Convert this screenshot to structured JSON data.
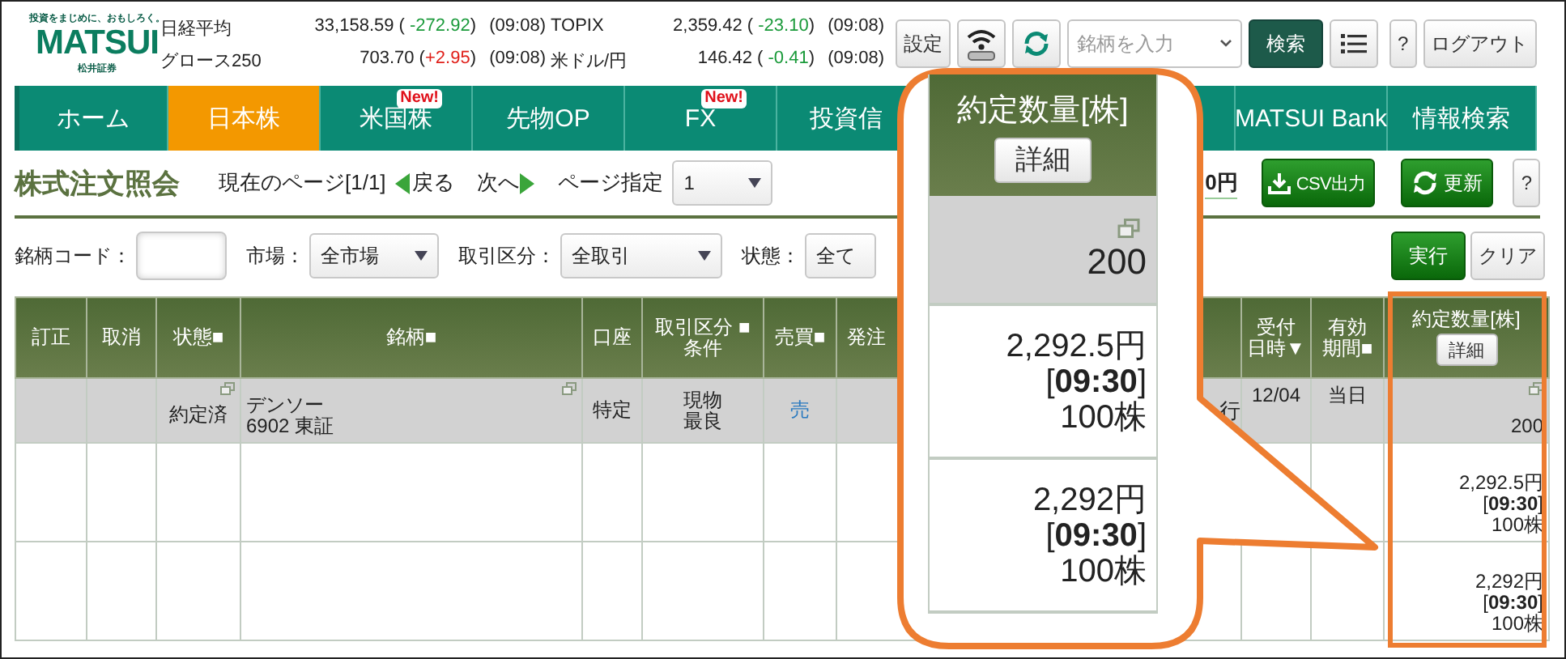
{
  "logo": {
    "tagline": "投資をまじめに、おもしろく。",
    "name": "MATSUI",
    "subname": "松井証券"
  },
  "indices": [
    {
      "name": "日経平均",
      "value": "33,158.59",
      "open": "( ",
      "change": "-272.92",
      "close": ")",
      "color": "#1a9a3a",
      "time": "(09:08)"
    },
    {
      "name": "TOPIX",
      "value": "2,359.42",
      "open": "( ",
      "change": "-23.10",
      "close": ")",
      "color": "#1a9a3a",
      "time": "(09:08)"
    },
    {
      "name": "グロース250",
      "value": "703.70",
      "open": "(",
      "change": "+2.95",
      "close": ")",
      "color": "#e0201a",
      "time": "(09:08)"
    },
    {
      "name": "米ドル/円",
      "value": "146.42",
      "open": "( ",
      "change": "-0.41",
      "close": ")",
      "color": "#1a9a3a",
      "time": "(09:08)"
    }
  ],
  "toolbar": {
    "settings": "設定",
    "search_placeholder": "銘柄を入力",
    "search_button": "検索",
    "help": "?",
    "logout": "ログアウト"
  },
  "nav_left": [
    {
      "label": "ホーム",
      "selected": false
    },
    {
      "label": "日本株",
      "selected": true
    },
    {
      "label": "米国株",
      "selected": false,
      "badge": "New!"
    },
    {
      "label": "先物OP",
      "selected": false
    },
    {
      "label": "FX",
      "selected": false,
      "badge": "New!"
    },
    {
      "label": "投資信",
      "selected": false
    }
  ],
  "nav_right": [
    {
      "label": "MATSUI Bank",
      "selected": false
    },
    {
      "label": "情報検索",
      "selected": false
    }
  ],
  "page": {
    "title": "株式注文照会",
    "current": "現在のページ[1/1]",
    "prev": "戻る",
    "next": "次へ",
    "page_label": "ページ指定",
    "page_value": "1",
    "amount": "0円",
    "csv": "CSV出力",
    "refresh": "更新",
    "help": "?"
  },
  "filters": [
    {
      "label": "銘柄コード：",
      "kind": "input"
    },
    {
      "label": "市場：",
      "kind": "select",
      "value": "全市場"
    },
    {
      "label": "取引区分：",
      "kind": "select",
      "value": "全取引"
    },
    {
      "label": "状態：",
      "kind": "select",
      "value": "全て"
    }
  ],
  "filter_buttons": {
    "run": "実行",
    "clear": "クリア"
  },
  "table": {
    "columns": [
      {
        "label": [
          "訂正"
        ]
      },
      {
        "label": [
          "取消"
        ]
      },
      {
        "label": [
          "状態■"
        ]
      },
      {
        "label": [
          "銘柄■"
        ]
      },
      {
        "label": [
          "口座"
        ]
      },
      {
        "label": [
          "取引区分 ■",
          "条件"
        ]
      },
      {
        "label": [
          "売買■"
        ]
      },
      {
        "label": [
          "発注"
        ]
      },
      {},
      {
        "label": [
          "受付",
          "日時▼"
        ]
      },
      {
        "label": [
          "有効",
          "期間■"
        ]
      },
      {
        "label": [
          "約定数量[株]"
        ],
        "button": "詳細"
      }
    ],
    "rows": [
      {
        "kind": "order",
        "cells": [
          null,
          null,
          {
            "text": [
              "約定済"
            ],
            "popup": true
          },
          {
            "text": [
              "デンソー",
              "6902 東証"
            ],
            "popup": true
          },
          {
            "text": [
              "特定"
            ]
          },
          {
            "text": [
              "現物",
              "最良"
            ]
          },
          {
            "text": [
              "売"
            ]
          },
          null,
          {
            "text": [
              "行"
            ]
          },
          {
            "text": [
              "12/04"
            ]
          },
          {
            "text": [
              "当日"
            ]
          },
          {
            "text": [
              "200"
            ],
            "popup": true
          }
        ]
      },
      {
        "kind": "execution",
        "cells": [
          null,
          null,
          null,
          null,
          null,
          null,
          null,
          null,
          null,
          null,
          null,
          {
            "text": [
              "2,292.5円",
              "[**09:30**]",
              "100株"
            ]
          }
        ]
      },
      {
        "kind": "execution",
        "cells": [
          null,
          null,
          null,
          null,
          null,
          null,
          null,
          null,
          null,
          null,
          null,
          {
            "text": [
              "2,292円",
              "[**09:30**]",
              "100株"
            ]
          }
        ]
      }
    ]
  },
  "callout": {
    "header": "約定数量[株]",
    "button": "詳細",
    "cells": [
      {
        "kind": "order",
        "text": [
          "200"
        ],
        "popup": true
      },
      {
        "kind": "execution",
        "text": [
          "2,292.5円",
          "[**09:30**]",
          "100株"
        ]
      },
      {
        "kind": "execution",
        "text": [
          "2,292円",
          "[**09:30**]",
          "100株"
        ]
      }
    ]
  }
}
